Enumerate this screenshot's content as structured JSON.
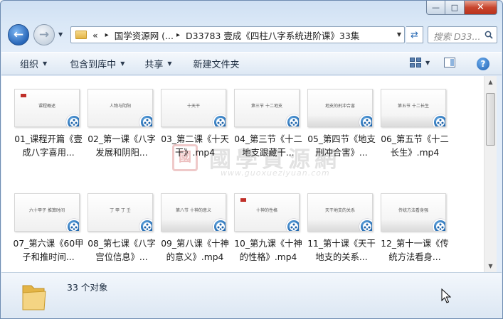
{
  "window": {
    "caption": {
      "minimize": "—",
      "maximize": "□",
      "close": "✕"
    }
  },
  "nav": {
    "address": {
      "overflow": "«",
      "crumbs": [
        "国学资源网 (...",
        "D33783 壹成《四柱八字系统进阶课》33集"
      ],
      "separator": "▸"
    },
    "search_placeholder": "搜索 D33..."
  },
  "toolbar": {
    "organize": "组织",
    "include_library": "包含到库中",
    "share": "共享",
    "new_folder": "新建文件夹"
  },
  "files": [
    {
      "name": "01_课程开篇《壹成八字喜用...",
      "thumb_text": "课程概述",
      "thumb_style": "red"
    },
    {
      "name": "02_第一课《八字发展和阴阳...",
      "thumb_text": "人物与阴阳",
      "thumb_style": "figure"
    },
    {
      "name": "03_第二课《十天干》.mp4",
      "thumb_text": "十天干",
      "thumb_style": "plain"
    },
    {
      "name": "04_第三节《十二地支跟藏干...",
      "thumb_text": "第三节 十二地支",
      "thumb_style": "plain"
    },
    {
      "name": "05_第四节《地支刑冲合害》...",
      "thumb_text": "地支的刑冲合害",
      "thumb_style": "mountain"
    },
    {
      "name": "06_第五节《十二长生》.mp4",
      "thumb_text": "第五节 十二长生",
      "thumb_style": "mountain"
    },
    {
      "name": "07_第六课《60甲子和推时间...",
      "thumb_text": "六十甲子 推算时间",
      "thumb_style": "plain"
    },
    {
      "name": "08_第七课《八字宫位信息》...",
      "thumb_text": "丁 甲 丁 壬",
      "thumb_style": "plain"
    },
    {
      "name": "09_第八课《十神的意义》.mp4",
      "thumb_text": "第八节 十神的意义",
      "thumb_style": "mountain"
    },
    {
      "name": "10_第九课《十神的性格》.mp4",
      "thumb_text": "十神的性格",
      "thumb_style": "red"
    },
    {
      "name": "11_第十课《天干地支的关系...",
      "thumb_text": "天干地支的关系",
      "thumb_style": "mountain"
    },
    {
      "name": "12_第十一课《传统方法看身...",
      "thumb_text": "传统方法看身强",
      "thumb_style": "mountain"
    }
  ],
  "watermark": {
    "seal": "國",
    "cn": "國學資源網",
    "url": "www.guoxueziyuan.com"
  },
  "status": {
    "count": "33 个对象"
  }
}
